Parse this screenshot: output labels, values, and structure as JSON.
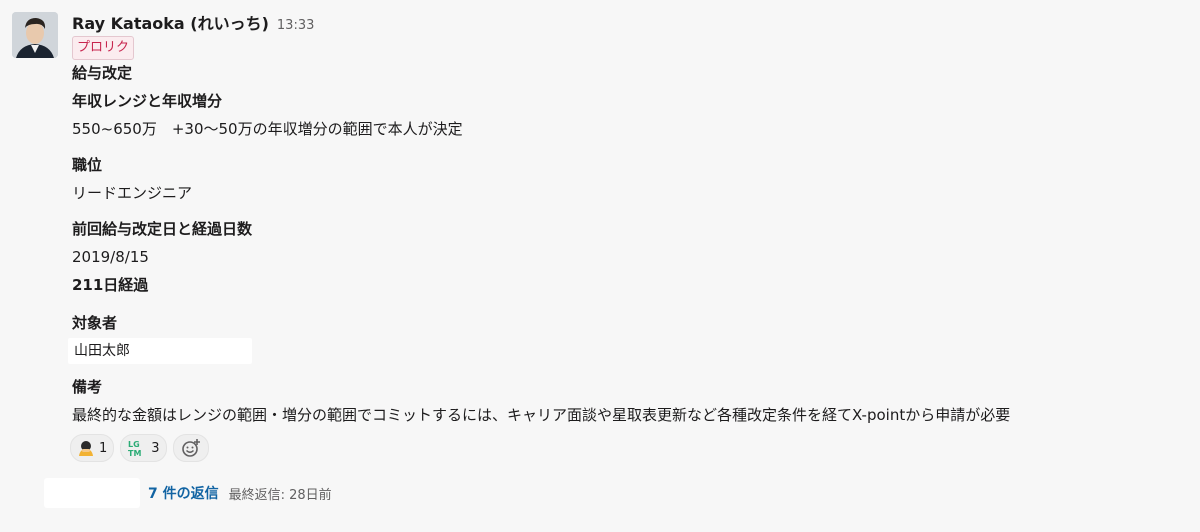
{
  "message": {
    "author": "Ray Kataoka (れいっち)",
    "time": "13:33",
    "badge": "プロリク",
    "title": "給与改定",
    "sections": {
      "range_heading": "年収レンジと年収増分",
      "range_value": "550~650万　+30〜50万の年収増分の範囲で本人が決定",
      "position_heading": "職位",
      "position_value": "リードエンジニア",
      "last_revision_heading": "前回給与改定日と経過日数",
      "last_revision_date": "2019/8/15",
      "elapsed_days": "211日経過",
      "target_heading": "対象者",
      "target_value": "山田太郎",
      "notes_heading": "備考",
      "notes_value": "最終的な金額はレンジの範囲・増分の範囲でコミットするには、キャリア面談や星取表更新など各種改定条件を経てX-pointから申請が必要"
    }
  },
  "reactions": [
    {
      "icon": "bowing-person-icon",
      "count": "1"
    },
    {
      "icon": "lgtm-icon",
      "count": "3"
    },
    {
      "icon": "add-reaction-icon",
      "count": ""
    }
  ],
  "thread": {
    "replies_label": "7 件の返信",
    "last_reply_label": "最終返信: 28日前"
  },
  "colors": {
    "background": "#f7f7f7",
    "link": "#1264a3",
    "badge_text": "#c7254e",
    "badge_bg": "#fbecef",
    "lgtm_green": "#2bac76"
  }
}
